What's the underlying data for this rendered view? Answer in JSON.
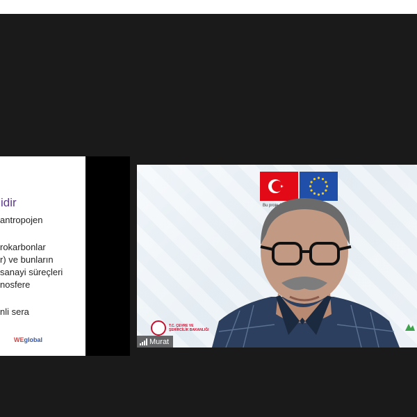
{
  "slide": {
    "title": "idir",
    "lines": [
      "antropojen",
      "rokarbonlar",
      "r) ve bunların",
      "sanayi süreçleri",
      "nosfere",
      "nli sera"
    ],
    "logo_we": "WE",
    "logo_rest": "global"
  },
  "video": {
    "participant_name": "Murat",
    "banner_text": "Bu proje Av",
    "ministry_line1": "T.C. ÇEVRE VE",
    "ministry_line2": "ŞEHİRCİLİK BAKANLIĞI"
  },
  "colors": {
    "stage_bg": "#1a1a1a",
    "slide_title": "#5b3a8a",
    "turkey_flag": "#e30a17",
    "eu_flag": "#1f4fa8",
    "ministry_red": "#c8102e"
  }
}
